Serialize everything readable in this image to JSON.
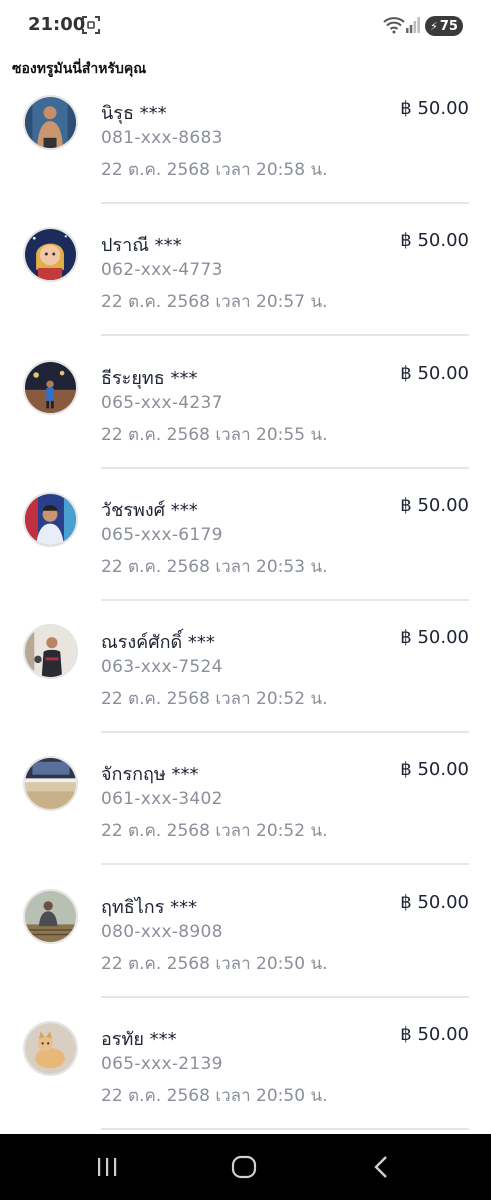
{
  "status_bar": {
    "time": "21:00",
    "battery": "75"
  },
  "section_title": "ซองทรูมันนี่สำหรับคุณ",
  "items": [
    {
      "name": "นิรุธ ***",
      "phone": "081-xxx-8683",
      "datetime": "22 ต.ค. 2568 เวลา 20:58 น.",
      "amount": "฿ 50.00",
      "avatar": "man-shirtless-avatar"
    },
    {
      "name": "ปราณี ***",
      "phone": "062-xxx-4773",
      "datetime": "22 ต.ค. 2568 เวลา 20:57 น.",
      "amount": "฿ 50.00",
      "avatar": "cartoon-girl-avatar"
    },
    {
      "name": "ธีระยุทธ ***",
      "phone": "065-xxx-4237",
      "datetime": "22 ต.ค. 2568 เวลา 20:55 น.",
      "amount": "฿ 50.00",
      "avatar": "night-field-avatar"
    },
    {
      "name": "วัชรพงศ์ ***",
      "phone": "065-xxx-6179",
      "datetime": "22 ต.ค. 2568 เวลา 20:53 น.",
      "amount": "฿ 50.00",
      "avatar": "selfie-avatar"
    },
    {
      "name": "ณรงค์ศักดิ์ ***",
      "phone": "063-xxx-7524",
      "datetime": "22 ต.ค. 2568 เวลา 20:52 น.",
      "amount": "฿ 50.00",
      "avatar": "man-standing-avatar"
    },
    {
      "name": "จักรกฤษ ***",
      "phone": "061-xxx-3402",
      "datetime": "22 ต.ค. 2568 เวลา 20:52 น.",
      "amount": "฿ 50.00",
      "avatar": "room-avatar"
    },
    {
      "name": "ฤทธิไกร ***",
      "phone": "080-xxx-8908",
      "datetime": "22 ต.ค. 2568 เวลา 20:50 น.",
      "amount": "฿ 50.00",
      "avatar": "man-sitting-avatar"
    },
    {
      "name": "อรทัย ***",
      "phone": "065-xxx-2139",
      "datetime": "22 ต.ค. 2568 เวลา 20:50 น.",
      "amount": "฿ 50.00",
      "avatar": "cat-avatar"
    }
  ],
  "colors": {
    "name": "#1e2433",
    "secondary": "#8a8f99",
    "divider": "#e6e6e6",
    "nav": "#000000"
  },
  "nav_icons": [
    "recent-apps-icon",
    "home-icon",
    "back-icon"
  ]
}
